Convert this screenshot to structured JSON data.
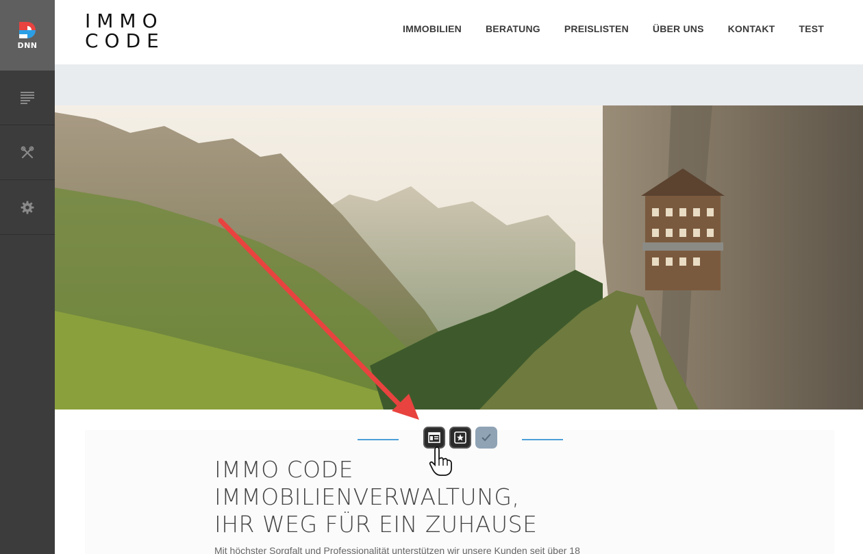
{
  "persona_bar": {
    "logo_text": "DNN",
    "items": [
      {
        "icon": "content-icon"
      },
      {
        "icon": "tools-icon"
      },
      {
        "icon": "settings-gear-icon"
      }
    ]
  },
  "header": {
    "brand_line1": "IMMO",
    "brand_line2": "CODE",
    "nav": [
      {
        "label": "IMMOBILIEN"
      },
      {
        "label": "BERATUNG"
      },
      {
        "label": "PREISLISTEN"
      },
      {
        "label": "ÜBER UNS"
      },
      {
        "label": "KONTAKT"
      },
      {
        "label": "TEST"
      }
    ]
  },
  "hero": {
    "image": "alpine-mountain-guesthouse-photo"
  },
  "module_toolbar": {
    "buttons": [
      {
        "icon": "module-content-icon"
      },
      {
        "icon": "module-star-icon"
      },
      {
        "icon": "checkmark-icon"
      }
    ]
  },
  "content": {
    "headline_line1": "IMMO CODE",
    "headline_line2": "IMMOBILIENVERWALTUNG,",
    "headline_line3": "IHR WEG FÜR EIN ZUHAUSE",
    "lead": "Mit höchster Sorgfalt und Professionalität unterstützen wir unsere Kunden seit über 18"
  },
  "colors": {
    "persona_bg": "#3d3c3c",
    "accent_blue": "#4a9fd8",
    "annotation_red": "#e8433f",
    "band_grey": "#e9ecef"
  }
}
